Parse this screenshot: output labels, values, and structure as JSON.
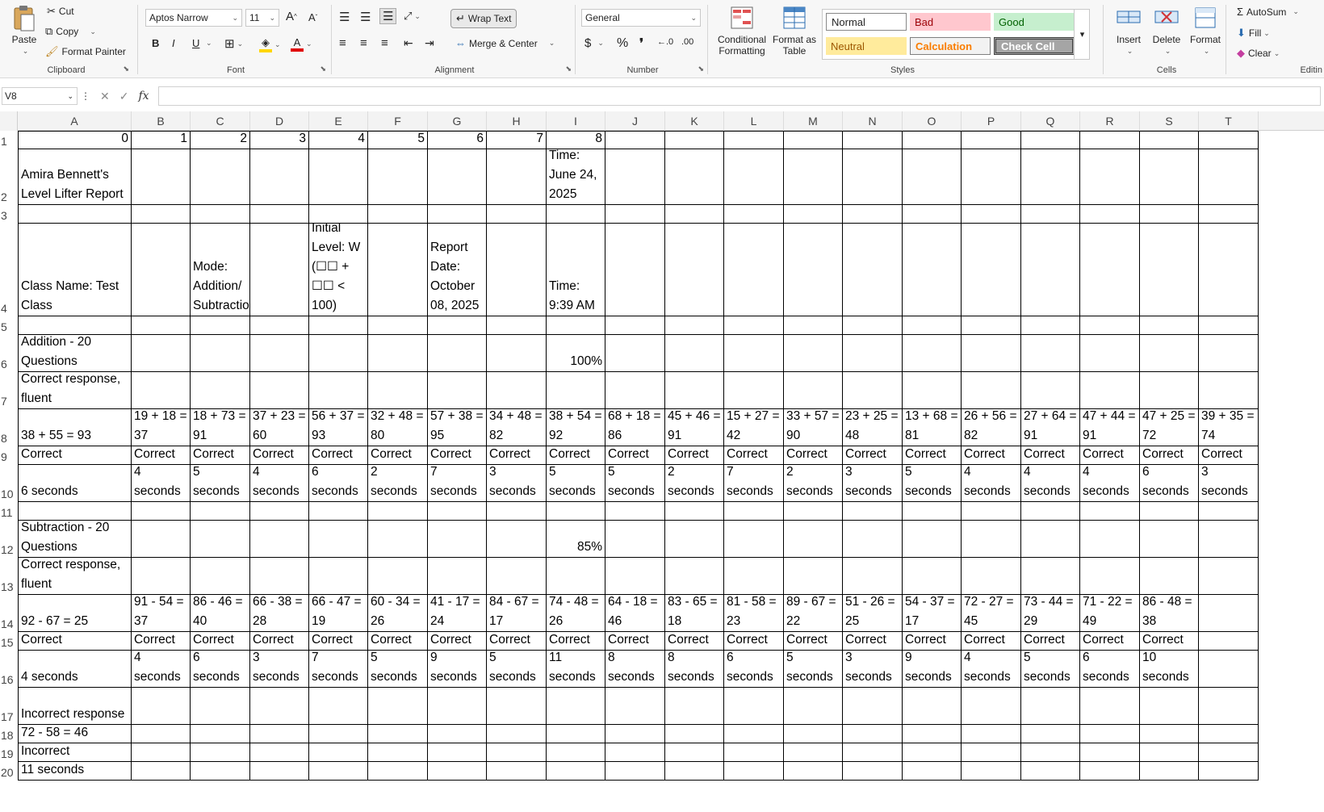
{
  "ribbon": {
    "clipboard": {
      "label": "Clipboard",
      "paste": "Paste",
      "cut": "Cut",
      "copy": "Copy",
      "format_painter": "Format Painter"
    },
    "font": {
      "label": "Font",
      "family": "Aptos Narrow",
      "size": "11",
      "bold": "B",
      "italic": "I",
      "underline": "U"
    },
    "alignment": {
      "label": "Alignment",
      "wrap_text": "Wrap Text",
      "merge_center": "Merge & Center"
    },
    "number": {
      "label": "Number",
      "format": "General"
    },
    "styles": {
      "label": "Styles",
      "conditional_formatting": "Conditional Formatting",
      "format_as_table": "Format as Table",
      "cells": [
        {
          "label": "Normal",
          "bg": "#ffffff",
          "fg": "#000000"
        },
        {
          "label": "Bad",
          "bg": "#ffc7ce",
          "fg": "#9c0006"
        },
        {
          "label": "Good",
          "bg": "#c6efce",
          "fg": "#006100"
        },
        {
          "label": "Neutral",
          "bg": "#ffeb9c",
          "fg": "#9c5700"
        },
        {
          "label": "Calculation",
          "bg": "#f2f2f2",
          "fg": "#fa7d00"
        },
        {
          "label": "Check Cell",
          "bg": "#a5a5a5",
          "fg": "#ffffff"
        }
      ]
    },
    "cells_group": {
      "label": "Cells",
      "insert": "Insert",
      "delete": "Delete",
      "format": "Format"
    },
    "editing": {
      "label": "Editin",
      "autosum": "AutoSum",
      "fill": "Fill",
      "clear": "Clear"
    }
  },
  "formula_bar": {
    "name_box": "V8",
    "fx": "fx",
    "value": ""
  },
  "sheet": {
    "columns": [
      "A",
      "B",
      "C",
      "D",
      "E",
      "F",
      "G",
      "H",
      "I",
      "J",
      "K",
      "L",
      "M",
      "N",
      "O",
      "P",
      "Q",
      "R",
      "S",
      "T"
    ],
    "rows": [
      "1",
      "2",
      "3",
      "4",
      "5",
      "6",
      "7",
      "8",
      "9",
      "10",
      "11",
      "12",
      "13",
      "14",
      "15",
      "16",
      "17",
      "18",
      "19",
      "20"
    ],
    "selected_cell": "V8",
    "row1": [
      "0",
      "1",
      "2",
      "3",
      "4",
      "5",
      "6",
      "7",
      "8"
    ],
    "row2": {
      "A": "Amira Bennett's Level Lifter Report",
      "I": "Time: June 24, 2025"
    },
    "row4": {
      "A": "Class Name: Test Class",
      "C": "Mode: Addition/ Subtraction",
      "E": "Initial Level: W (☐☐ + ☐☐ < 100)",
      "G": "Report Date: October 08, 2025",
      "I": "Time: 9:39 AM"
    },
    "row6": {
      "A": "Addition - 20 Questions",
      "I": "100%"
    },
    "row7": {
      "A": "Correct response, fluent"
    },
    "row8": [
      "38 + 55 = 93",
      "19 + 18 = 37",
      "18 + 73 = 91",
      "37 + 23 = 60",
      "56 + 37 = 93",
      "32 + 48 = 80",
      "57 + 38 = 95",
      "34 + 48 = 82",
      "38 + 54 = 92",
      "68 + 18 = 86",
      "45 + 46 = 91",
      "15 + 27 = 42",
      "33 + 57 = 90",
      "23 + 25 = 48",
      "13 + 68 = 81",
      "26 + 56 = 82",
      "27 + 64 = 91",
      "47 + 44 = 91",
      "47 + 25 = 72",
      "39 + 35 = 74"
    ],
    "row9": [
      "Correct",
      "Correct",
      "Correct",
      "Correct",
      "Correct",
      "Correct",
      "Correct",
      "Correct",
      "Correct",
      "Correct",
      "Correct",
      "Correct",
      "Correct",
      "Correct",
      "Correct",
      "Correct",
      "Correct",
      "Correct",
      "Correct",
      "Correct"
    ],
    "row10": [
      "6 seconds",
      "4 seconds",
      "5 seconds",
      "4 seconds",
      "6 seconds",
      "2 seconds",
      "7 seconds",
      "3 seconds",
      "5 seconds",
      "5 seconds",
      "2 seconds",
      "7 seconds",
      "2 seconds",
      "3 seconds",
      "5 seconds",
      "4 seconds",
      "4 seconds",
      "4 seconds",
      "6 seconds",
      "3 seconds"
    ],
    "row12": {
      "A": "Subtraction - 20 Questions",
      "I": "85%"
    },
    "row13": {
      "A": "Correct response, fluent"
    },
    "row14": [
      "92 - 67 = 25",
      "91 - 54 = 37",
      "86 - 46 = 40",
      "66 - 38 = 28",
      "66 - 47 = 19",
      "60 - 34 = 26",
      "41 - 17 = 24",
      "84 - 67 = 17",
      "74 - 48 = 26",
      "64 - 18 = 46",
      "83 - 65 = 18",
      "81 - 58 = 23",
      "89 - 67 = 22",
      "51 - 26 = 25",
      "54 - 37 = 17",
      "72 - 27 = 45",
      "73 - 44 = 29",
      "71 - 22 = 49",
      "86 - 48 = 38",
      ""
    ],
    "row15": [
      "Correct",
      "Correct",
      "Correct",
      "Correct",
      "Correct",
      "Correct",
      "Correct",
      "Correct",
      "Correct",
      "Correct",
      "Correct",
      "Correct",
      "Correct",
      "Correct",
      "Correct",
      "Correct",
      "Correct",
      "Correct",
      "Correct",
      ""
    ],
    "row16": [
      "4 seconds",
      "4 seconds",
      "6 seconds",
      "3 seconds",
      "7 seconds",
      "5 seconds",
      "9 seconds",
      "5 seconds",
      "11 seconds",
      "8 seconds",
      "8 seconds",
      "6 seconds",
      "5 seconds",
      "3 seconds",
      "9 seconds",
      "4 seconds",
      "5 seconds",
      "6 seconds",
      "10 seconds",
      ""
    ],
    "row17": {
      "A": "Incorrect response"
    },
    "row18": {
      "A": "72 - 58 = 46"
    },
    "row19": {
      "A": "Incorrect"
    },
    "row20": {
      "A": "11 seconds"
    }
  }
}
